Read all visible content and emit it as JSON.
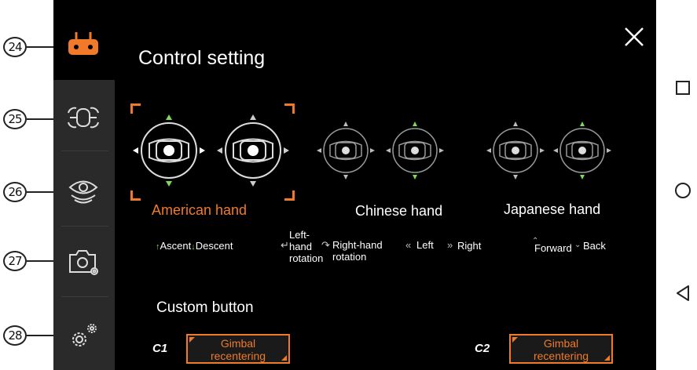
{
  "callouts": [
    "24",
    "25",
    "26",
    "27",
    "28"
  ],
  "sidebar": {
    "items": [
      {
        "icon": "remote-controller-icon",
        "active": true
      },
      {
        "icon": "aircraft-icon",
        "active": false
      },
      {
        "icon": "vision-eye-icon",
        "active": false
      },
      {
        "icon": "camera-settings-icon",
        "active": false
      },
      {
        "icon": "gear-settings-icon",
        "active": false
      }
    ]
  },
  "header": {
    "title": "Control setting"
  },
  "modes": [
    {
      "label": "American hand",
      "selected": true
    },
    {
      "label": "Chinese hand",
      "selected": false
    },
    {
      "label": "Japanese hand",
      "selected": false
    }
  ],
  "legend": {
    "ascent": "Ascent",
    "descent": "Descent",
    "left_rotation": "Left-\nhand\nrotation",
    "right_rotation": "Right-hand\nrotation",
    "left": "Left",
    "right": "Right",
    "forward": "Forward",
    "back": "Back"
  },
  "custom": {
    "title": "Custom button",
    "c1_label": "C1",
    "c1_value": "Gimbal recentering",
    "c2_label": "C2",
    "c2_value": "Gimbal recentering"
  },
  "colors": {
    "accent": "#f07a2a",
    "green_arrow": "#7ed957",
    "screen": "#000000",
    "sidebar": "#2a2a2a"
  }
}
